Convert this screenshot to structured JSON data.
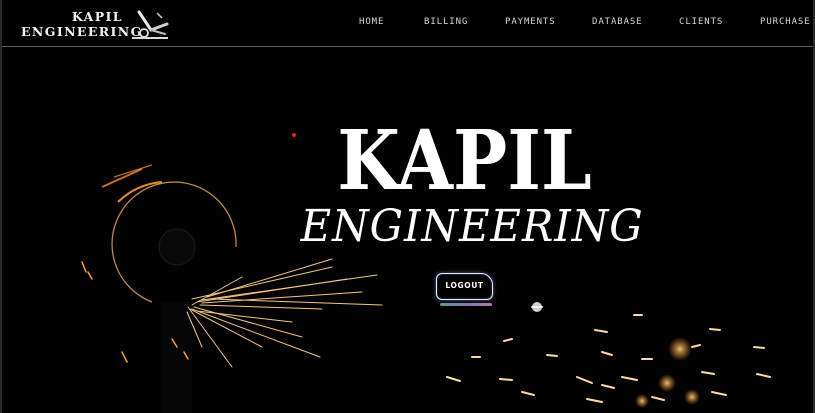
{
  "brand": {
    "line1": "KAPIL",
    "line2": "ENGINEERING",
    "icon": "welding-torch-icon"
  },
  "nav": {
    "items": [
      {
        "label": "HOME"
      },
      {
        "label": "BILLING"
      },
      {
        "label": "PAYMENTS"
      },
      {
        "label": "DATABASE"
      },
      {
        "label": "CLIENTS"
      },
      {
        "label": "PURCHASE"
      }
    ]
  },
  "hero": {
    "title": "KAPIL",
    "subtitle": "ENGINEERING",
    "logout_label": "LOGOUT",
    "background": "angle-grinder-sparks-photo"
  },
  "colors": {
    "background": "#000000",
    "text": "#ffffff",
    "spark": "#ffb347",
    "divider": "#5c5c5c"
  }
}
